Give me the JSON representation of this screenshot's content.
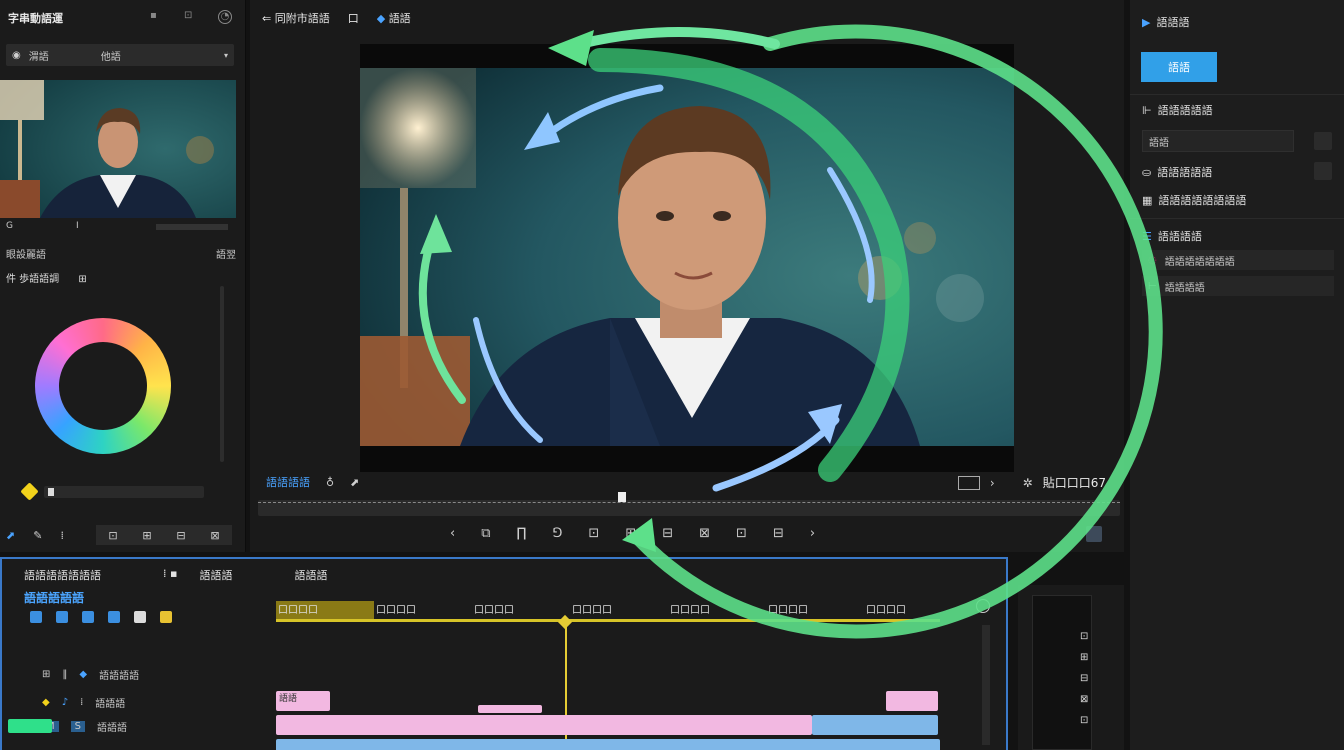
{
  "left_panel": {
    "title": "字串動語運",
    "source_select": "渭語",
    "source_select_right": "他語",
    "thumb_left_label": "G",
    "thumb_right_label": "I",
    "row1_left": "眼設麗語",
    "row1_right": "語翌",
    "row2_label": "件 歩語語調",
    "row2_icon": "⊞"
  },
  "center_panel": {
    "header_title": "同附市語語",
    "header_tab1": "口",
    "header_tab2": "語語",
    "transport_label": "語語語語",
    "timecode": "貼口口口67",
    "controls": [
      "‹",
      "⧉",
      "∏",
      "⅁",
      "⊡",
      "⊞",
      "⊟",
      "⊠",
      "⊡",
      "⊟",
      "›"
    ]
  },
  "right_panel": {
    "section1_title": "語語語",
    "primary_button": "語語",
    "section2_title": "語語語語語",
    "input_value": "語語",
    "row_a": "語語語語語",
    "row_b": "語語語語語語語語",
    "section3_title": "語語語語",
    "list_item1": "語語語語語語語",
    "list_item2": "語語語語"
  },
  "timeline": {
    "title": "語語語語語語語",
    "tab1": "語語語",
    "tab2": "語語語",
    "timecode": "語語語語語",
    "ruler_labels": [
      "口口口口",
      "口口口口",
      "口口口口",
      "口口口口",
      "口口口口",
      "口口口口",
      "口口口口"
    ],
    "track_v": "語語語語",
    "track_a1": "語語語",
    "track_a2": "語語語",
    "clip_label": "語語"
  },
  "colors": {
    "accent_blue": "#31a0e8",
    "timeline_border": "#3a79c9",
    "playhead_yellow": "#e5cc34",
    "clip_pink": "#f2b8e1",
    "clip_blue": "#7fb7e8",
    "arrow_green": "#5de08a",
    "arrow_blue": "#8fc6ff"
  }
}
